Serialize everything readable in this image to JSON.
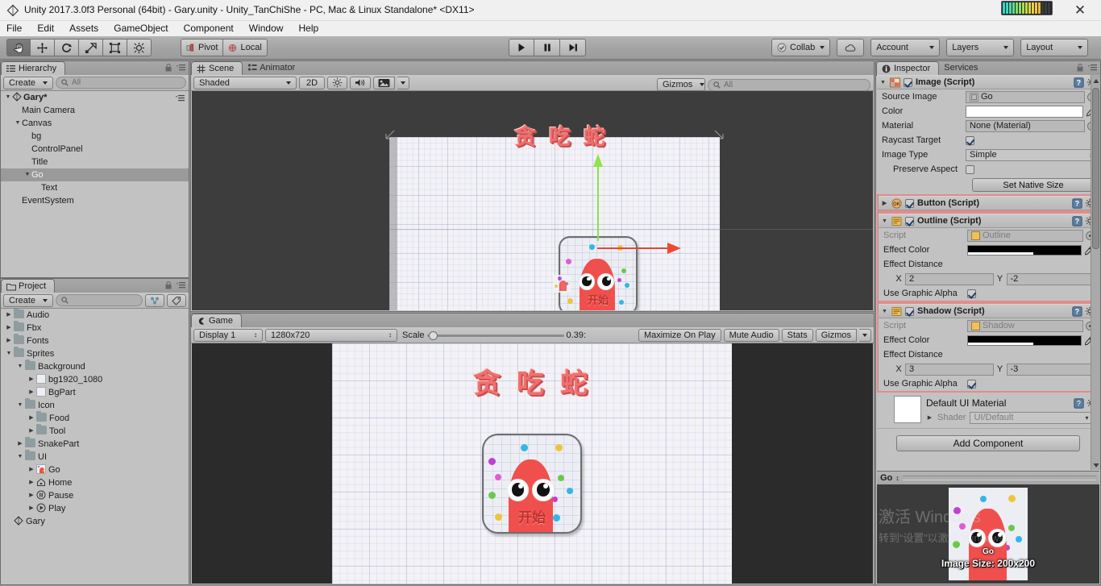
{
  "window": {
    "title": "Unity 2017.3.0f3 Personal (64bit) - Gary.unity - Unity_TanChiShe - PC, Mac & Linux Standalone* <DX11>",
    "close_label": "✕",
    "app_icon": "unity-logo-icon"
  },
  "menubar": {
    "items": [
      "File",
      "Edit",
      "Assets",
      "GameObject",
      "Component",
      "Window",
      "Help"
    ]
  },
  "toolbar": {
    "transform_tools": [
      {
        "name": "hand-tool",
        "icon": "hand-icon",
        "active": true
      },
      {
        "name": "move-tool",
        "icon": "move-arrows-icon",
        "active": false
      },
      {
        "name": "rotate-tool",
        "icon": "rotate-icon",
        "active": false
      },
      {
        "name": "scale-tool",
        "icon": "scale-icon",
        "active": false
      },
      {
        "name": "rect-tool",
        "icon": "rect-transform-icon",
        "active": false
      },
      {
        "name": "transform-tool",
        "icon": "combined-transform-icon",
        "active": false
      }
    ],
    "pivot_label": "Pivot",
    "local_label": "Local",
    "play_label": "play-icon",
    "pause_label": "pause-icon",
    "step_label": "step-icon",
    "collab_label": "Collab",
    "cloud_label": "cloud-icon",
    "account_label": "Account",
    "layers_label": "Layers",
    "layout_label": "Layout"
  },
  "hierarchy": {
    "tab_label": "Hierarchy",
    "create_label": "Create",
    "search_placeholder": "All",
    "search_value": "",
    "rows": [
      {
        "label": "Gary*",
        "depth": 0,
        "arrow": "down",
        "icon": "scene-icon",
        "selected": false,
        "scene": true
      },
      {
        "label": "Main Camera",
        "depth": 1,
        "arrow": "",
        "icon": "",
        "selected": false
      },
      {
        "label": "Canvas",
        "depth": 1,
        "arrow": "down",
        "icon": "",
        "selected": false
      },
      {
        "label": "bg",
        "depth": 2,
        "arrow": "",
        "icon": "",
        "selected": false
      },
      {
        "label": "ControlPanel",
        "depth": 2,
        "arrow": "",
        "icon": "",
        "selected": false
      },
      {
        "label": "Title",
        "depth": 2,
        "arrow": "",
        "icon": "",
        "selected": false
      },
      {
        "label": "Go",
        "depth": 2,
        "arrow": "down",
        "icon": "",
        "selected": true
      },
      {
        "label": "Text",
        "depth": 3,
        "arrow": "",
        "icon": "",
        "selected": false
      },
      {
        "label": "EventSystem",
        "depth": 1,
        "arrow": "",
        "icon": "",
        "selected": false
      }
    ]
  },
  "project": {
    "tab_label": "Project",
    "create_label": "Create",
    "search_placeholder": "",
    "search_value": "",
    "rows": [
      {
        "label": "Audio",
        "depth": 0,
        "arrow": "right",
        "kind": "folder"
      },
      {
        "label": "Fbx",
        "depth": 0,
        "arrow": "right",
        "kind": "folder"
      },
      {
        "label": "Fonts",
        "depth": 0,
        "arrow": "right",
        "kind": "folder"
      },
      {
        "label": "Sprites",
        "depth": 0,
        "arrow": "down",
        "kind": "folder"
      },
      {
        "label": "Background",
        "depth": 1,
        "arrow": "down",
        "kind": "folder"
      },
      {
        "label": "bg1920_1080",
        "depth": 2,
        "arrow": "right",
        "kind": "sprite",
        "swatch": "#eceef4"
      },
      {
        "label": "BgPart",
        "depth": 2,
        "arrow": "right",
        "kind": "sprite",
        "swatch": "#eeeef6"
      },
      {
        "label": "Icon",
        "depth": 1,
        "arrow": "down",
        "kind": "folder"
      },
      {
        "label": "Food",
        "depth": 2,
        "arrow": "right",
        "kind": "folder"
      },
      {
        "label": "Tool",
        "depth": 2,
        "arrow": "right",
        "kind": "folder"
      },
      {
        "label": "SnakePart",
        "depth": 1,
        "arrow": "right",
        "kind": "folder"
      },
      {
        "label": "UI",
        "depth": 1,
        "arrow": "down",
        "kind": "folder"
      },
      {
        "label": "Go",
        "depth": 2,
        "arrow": "right",
        "kind": "go-sprite"
      },
      {
        "label": "Home",
        "depth": 2,
        "arrow": "right",
        "kind": "home-icon"
      },
      {
        "label": "Pause",
        "depth": 2,
        "arrow": "right",
        "kind": "pause-icon"
      },
      {
        "label": "Play",
        "depth": 2,
        "arrow": "right",
        "kind": "play-icon"
      },
      {
        "label": "Gary",
        "depth": 0,
        "arrow": "",
        "kind": "scene"
      }
    ]
  },
  "scene_view": {
    "tabs": [
      {
        "label": "Scene",
        "icon": "scene-grid-icon",
        "active": true
      },
      {
        "label": "Animator",
        "icon": "animator-icon",
        "active": false
      }
    ],
    "shading_mode": "Shaded",
    "mode_2d": "2D",
    "lighting_icon": "sun-icon",
    "audio_icon": "speaker-icon",
    "fx_icon": "image-effects-icon",
    "gizmos_label": "Gizmos",
    "search_placeholder": "All",
    "search_value": ""
  },
  "game_view": {
    "tab_label": "Game",
    "display_label": "Display 1",
    "resolution_label": "1280x720",
    "scale_label": "Scale",
    "scale_value": "0.39:",
    "maximize_label": "Maximize On Play",
    "mute_label": "Mute Audio",
    "stats_label": "Stats",
    "gizmos_label": "Gizmos"
  },
  "game_content": {
    "title_text": "贪 吃 蛇",
    "button_text": "开始",
    "title_color": "#f0706f",
    "blob_color": "#f0504d"
  },
  "inspector": {
    "tabs": [
      {
        "label": "Inspector",
        "icon": "info-icon",
        "active": true
      },
      {
        "label": "Services",
        "icon": "",
        "active": false
      }
    ],
    "components": [
      {
        "name": "Image (Script)",
        "icon": "image-script-icon",
        "enabled": true,
        "expanded": true,
        "selected": false,
        "fields": [
          {
            "label": "Source Image",
            "type": "object",
            "value": "Go",
            "indent": false
          },
          {
            "label": "Color",
            "type": "color-white",
            "value": "",
            "indent": false
          },
          {
            "label": "Material",
            "type": "object-plain",
            "value": "None (Material)",
            "indent": false
          },
          {
            "label": "Raycast Target",
            "type": "checkbox",
            "value": true,
            "indent": false
          },
          {
            "label": "Image Type",
            "type": "dropdown",
            "value": "Simple",
            "indent": false
          },
          {
            "label": "Preserve Aspect",
            "type": "checkbox",
            "value": false,
            "indent": true
          }
        ],
        "button": "Set Native Size"
      },
      {
        "name": "Button (Script)",
        "icon": "button-script-icon",
        "enabled": true,
        "expanded": false,
        "selected": true,
        "fields": []
      },
      {
        "name": "Outline (Script)",
        "icon": "script-icon",
        "enabled": true,
        "expanded": true,
        "selected": true,
        "fields": [
          {
            "label": "Script",
            "type": "object-dim",
            "value": "Outline",
            "indent": false
          },
          {
            "label": "Effect Color",
            "type": "color-black",
            "value": "",
            "indent": false
          },
          {
            "label": "Effect Distance",
            "type": "header",
            "value": "",
            "indent": false
          },
          {
            "label": "",
            "type": "xy",
            "x_label": "X",
            "x": "2",
            "y_label": "Y",
            "y": "-2",
            "indent": true
          },
          {
            "label": "Use Graphic Alpha",
            "type": "checkbox",
            "value": true,
            "indent": false
          }
        ]
      },
      {
        "name": "Shadow (Script)",
        "icon": "script-icon",
        "enabled": true,
        "expanded": true,
        "selected": true,
        "fields": [
          {
            "label": "Script",
            "type": "object-dim",
            "value": "Shadow",
            "indent": false
          },
          {
            "label": "Effect Color",
            "type": "color-black",
            "value": "",
            "indent": false
          },
          {
            "label": "Effect Distance",
            "type": "header",
            "value": "",
            "indent": false
          },
          {
            "label": "",
            "type": "xy",
            "x_label": "X",
            "x": "3",
            "y_label": "Y",
            "y": "-3",
            "indent": true
          },
          {
            "label": "Use Graphic Alpha",
            "type": "checkbox",
            "value": true,
            "indent": false
          }
        ]
      }
    ],
    "material": {
      "name": "Default UI Material",
      "shader_label": "Shader",
      "shader_value": "UI/Default"
    },
    "add_component_label": "Add Component"
  },
  "preview": {
    "title": "Go",
    "overlay_label": "Go",
    "size_label": "Image Size: 200x200"
  },
  "watermark": {
    "line1": "激活 Windows",
    "line2": "转到“设置”以激活 Windows。"
  },
  "colors": {
    "selection_outline": "#e38b8b",
    "panel_bg": "#c2c2c2",
    "toolbar_bg": "#a4a4a4",
    "scene_bg": "#3d3d3d",
    "game_bg": "#2b2b2b",
    "accent_red": "#f0504d"
  }
}
